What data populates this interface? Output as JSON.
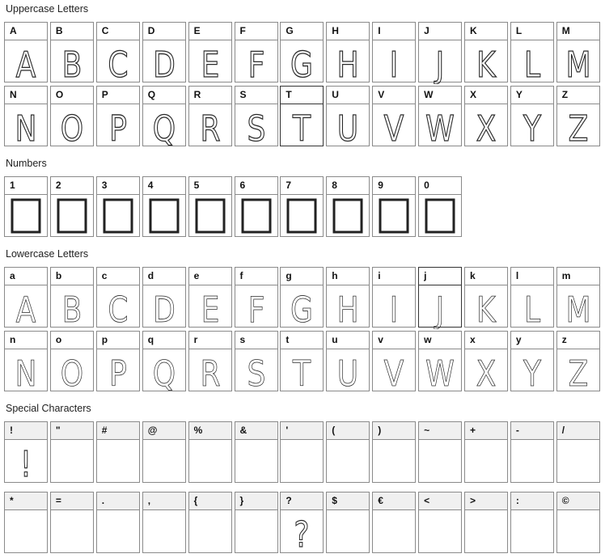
{
  "sections": {
    "uppercase": "Uppercase Letters",
    "numbers": "Numbers",
    "lowercase": "Lowercase Letters",
    "special": "Special Characters"
  },
  "uppercase": [
    "A",
    "B",
    "C",
    "D",
    "E",
    "F",
    "G",
    "H",
    "I",
    "J",
    "K",
    "L",
    "M",
    "N",
    "O",
    "P",
    "Q",
    "R",
    "S",
    "T",
    "U",
    "V",
    "W",
    "X",
    "Y",
    "Z"
  ],
  "numbers": [
    "1",
    "2",
    "3",
    "4",
    "5",
    "6",
    "7",
    "8",
    "9",
    "0"
  ],
  "lowercase": [
    "a",
    "b",
    "c",
    "d",
    "e",
    "f",
    "g",
    "h",
    "i",
    "j",
    "k",
    "l",
    "m",
    "n",
    "o",
    "p",
    "q",
    "r",
    "s",
    "t",
    "u",
    "v",
    "w",
    "x",
    "y",
    "z"
  ],
  "special": [
    "!",
    "\"",
    "#",
    "@",
    "%",
    "&",
    "'",
    "(",
    ")",
    "~",
    "+",
    "-",
    "/",
    "*",
    "=",
    ".",
    ",",
    "{",
    "}",
    "?",
    "$",
    "€",
    "<",
    ">",
    ":",
    "©"
  ]
}
